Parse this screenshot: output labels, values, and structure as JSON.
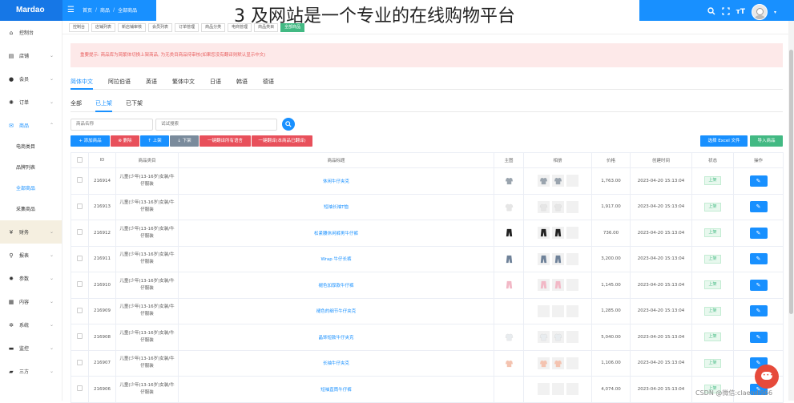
{
  "app": {
    "logo": "Mardao",
    "overlay_title": "3 及网站是一个专业的在线购物平台"
  },
  "breadcrumb": [
    "首页",
    "商品",
    "全部商品"
  ],
  "page_tabs": [
    "控制台",
    "店铺列表",
    "新店铺审核",
    "会员列表",
    "订单管理",
    "商品分类",
    "电商管理",
    "商品类目",
    "全部商品"
  ],
  "sidebar": {
    "items": [
      {
        "label": "控制台",
        "icon": "home-icon"
      },
      {
        "label": "店铺",
        "icon": "store-icon"
      },
      {
        "label": "会员",
        "icon": "user-icon"
      },
      {
        "label": "订单",
        "icon": "gear-icon"
      },
      {
        "label": "商品",
        "icon": "mail-icon"
      }
    ],
    "sub_items": [
      "电商类目",
      "品牌列表",
      "全部商品",
      "采集商品"
    ],
    "items_after": [
      {
        "label": "财务",
        "icon": "yen-icon"
      },
      {
        "label": "报表",
        "icon": "search-icon"
      },
      {
        "label": "参数",
        "icon": "gear-icon"
      },
      {
        "label": "内容",
        "icon": "grid-icon"
      },
      {
        "label": "系统",
        "icon": "settings-icon"
      },
      {
        "label": "监控",
        "icon": "monitor-icon"
      },
      {
        "label": "三方",
        "icon": "lock-icon"
      }
    ]
  },
  "alert": "重要提示: 商品库为简繁体切换上架商品, 为无类目商品待审核(如果您没有翻译则默认显示中文)",
  "lang_tabs": [
    "简体中文",
    "阿拉伯语",
    "英语",
    "繁体中文",
    "日语",
    "韩语",
    "德语"
  ],
  "status_tabs": [
    "全部",
    "已上架",
    "已下架"
  ],
  "search": {
    "name_placeholder": "商品名称",
    "keyword_placeholder": "试试搜索"
  },
  "actions": {
    "add": "+ 添加商品",
    "delete": "删除",
    "up": "上架",
    "down": "下架",
    "one_click_up": "一键翻译所有语言",
    "one_click_trans": "一键翻译(本商品已翻译)",
    "export": "选择 Excel 文件",
    "import": "导入商品"
  },
  "table": {
    "headers": [
      "",
      "ID",
      "商品类目",
      "商品标题",
      "主图",
      "相册",
      "价格",
      "创建时间",
      "状态",
      "操作"
    ],
    "category": "儿童(少年(13-16岁)女装/牛仔服装",
    "status": "上架",
    "rows": [
      {
        "id": "216914",
        "title": "休闲牛仔夹克",
        "price": "1,763.00",
        "time": "2023-04-20 15:13:04",
        "kind": "jacket"
      },
      {
        "id": "216913",
        "title": "短袖长袖T恤",
        "price": "1,917.00",
        "time": "2023-04-20 15:13:04",
        "kind": "tee"
      },
      {
        "id": "216912",
        "title": "松紧腰休闲裤男牛仔裤",
        "price": "736.00",
        "time": "2023-04-20 15:13:04",
        "kind": "pants"
      },
      {
        "id": "216911",
        "title": "Wrap 牛仔长裤",
        "price": "3,200.00",
        "time": "2023-04-20 15:13:04",
        "kind": "jeans"
      },
      {
        "id": "216910",
        "title": "褪色加厚款牛仔裤",
        "price": "1,145.00",
        "time": "2023-04-20 15:13:04",
        "kind": "pink"
      },
      {
        "id": "216909",
        "title": "褪色的细节牛仔夹克",
        "price": "1,285.00",
        "time": "2023-04-20 15:13:04",
        "kind": "blank"
      },
      {
        "id": "216908",
        "title": "晶饰短款牛仔夹克",
        "price": "5,040.00",
        "time": "2023-04-20 15:13:04",
        "kind": "light"
      },
      {
        "id": "216907",
        "title": "长袖牛仔夹克",
        "price": "1,106.00",
        "time": "2023-04-20 15:13:04",
        "kind": "peach"
      },
      {
        "id": "216906",
        "title": "短袖直筒牛仔裤",
        "price": "4,074.00",
        "time": "2023-04-20 15:13:04",
        "kind": "blank"
      }
    ]
  },
  "watermark": "CSDN @微信:claendi966",
  "colors": {
    "primary": "#1890ff",
    "success": "#42b983",
    "danger": "#e8505b",
    "alert_bg": "#fde9e9"
  }
}
